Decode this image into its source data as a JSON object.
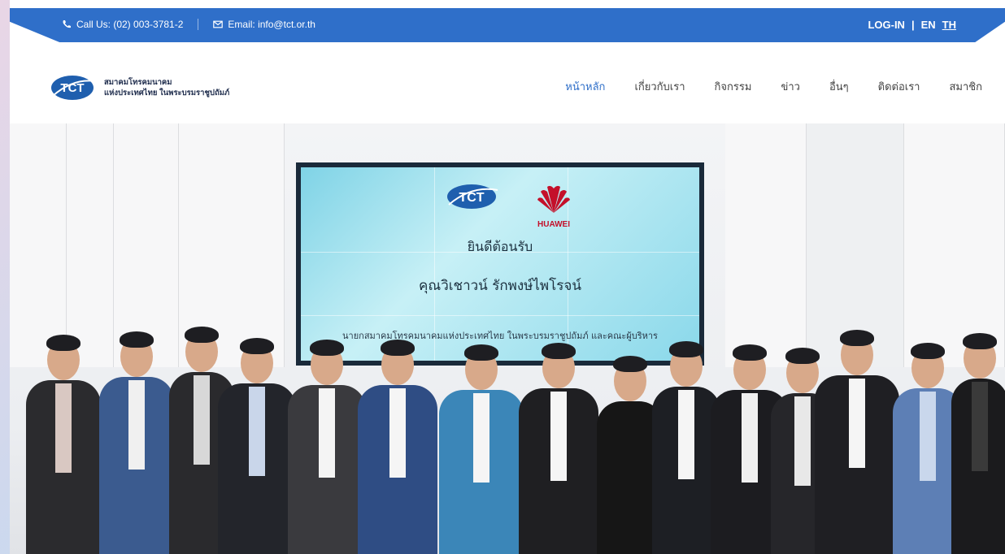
{
  "topbar": {
    "phone": "Call Us: (02) 003-3781-2",
    "email": "Email: info@tct.or.th",
    "login": "LOG-IN",
    "divider": "|",
    "lang_en": "EN",
    "lang_th": "TH"
  },
  "logo": {
    "mark": "TCT",
    "line1": "สมาคมโทรคมนาคม",
    "line2": "แห่งประเทศไทย ในพระบรมราชูปถัมภ์"
  },
  "nav": {
    "items": [
      {
        "label": "หน้าหลัก",
        "active": true
      },
      {
        "label": "เกี่ยวกับเรา",
        "active": false
      },
      {
        "label": "กิจกรรม",
        "active": false
      },
      {
        "label": "ข่าว",
        "active": false
      },
      {
        "label": "อื่นๆ",
        "active": false
      },
      {
        "label": "ติดต่อเรา",
        "active": false
      },
      {
        "label": "สมาชิก",
        "active": false
      }
    ]
  },
  "hero": {
    "screen_logo": "TCT",
    "brand": "HUAWEI",
    "welcome": "ยินดีต้อนรับ",
    "guest": "คุณวิเชาวน์ รักพงษ์ไพโรจน์",
    "subline": "นายกสมาคมโทรคมนาคมแห่งประเทศไทย ในพระบรมราชูปถัมภ์ และคณะผู้บริหาร"
  },
  "colors": {
    "brand_blue": "#2f6fc9",
    "huawei_red": "#c4102a"
  },
  "icons": {
    "phone": "phone-icon",
    "email": "envelope-icon"
  }
}
